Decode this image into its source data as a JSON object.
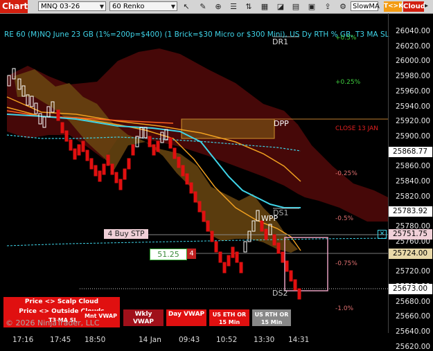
{
  "toolbar": {
    "title": "Chart",
    "instrument": "MNQ 03-26",
    "bar_type": "60 Renko",
    "slow_ma": "SlowMA",
    "tck_button": "T<>K",
    "cloud_button": "Cloud"
  },
  "chart": {
    "header": "RE 60 (M)NQ June 23 GB (1%=200p=$400) (1 Brick=$30 Micro or $300 Mini), US Dy RTH % GB, T3 MA SL",
    "y_ticks": [
      "26040.00",
      "26020.00",
      "26000.00",
      "25980.00",
      "25960.00",
      "25940.00",
      "25920.00",
      "25900.00",
      "25880.00",
      "25860.00",
      "25840.00",
      "25820.00",
      "25800.00",
      "25780.00",
      "25760.00",
      "25740.00",
      "25720.00",
      "25700.00",
      "25680.00",
      "25660.00",
      "25640.00",
      "25620.00"
    ],
    "x_ticks": [
      "17:16",
      "17:45",
      "18:50",
      "14 Jan",
      "09:43",
      "10:52",
      "13:30",
      "14:31"
    ],
    "level_labels": {
      "dr1": "DR1",
      "dpp": "DPP",
      "ds1": "DS1",
      "wpp": "WPP",
      "ds2": "DS2"
    },
    "pct_labels": {
      "p05": "+0.5%",
      "p025": "+0.25%",
      "close": "CLOSE 13 JAN",
      "m025": "-0.25%",
      "m05": "-0.5%",
      "m075": "-0.75%",
      "m10": "-1.0%"
    },
    "price_tags": {
      "p1": "25868.77",
      "p2": "25783.92",
      "p3": "25751.75",
      "p4": "25724.00",
      "p5": "25673.00"
    },
    "order": {
      "label": "4 Buy STP",
      "box_value": "51.25",
      "qty": "4"
    },
    "panel": {
      "scalp": "Price <> Scalp Cloud",
      "outside": "Price <> Outside Clouds",
      "tsmasl": "T3 MA SL",
      "mnt_vwap": "Mnt VWAP",
      "wkly_vwap": "Wkly VWAP",
      "day_vwap": "Day VWAP",
      "us_eth": "US ETH OR 15 Min",
      "us_rth": "US RTH OR 15 Min"
    },
    "copyright": "© 2026 NinjaTrader, LLC"
  },
  "colors": {
    "up": "#ffffff",
    "down": "#e01010",
    "cloud_bear": "#4a0a0a",
    "cloud_bull": "#6a4a10",
    "cyan": "#3fd4e8",
    "orange": "#f0a020"
  },
  "chart_data": {
    "type": "candlestick-renko",
    "ylim": [
      25610,
      26050
    ],
    "note_last": 25673.0
  }
}
